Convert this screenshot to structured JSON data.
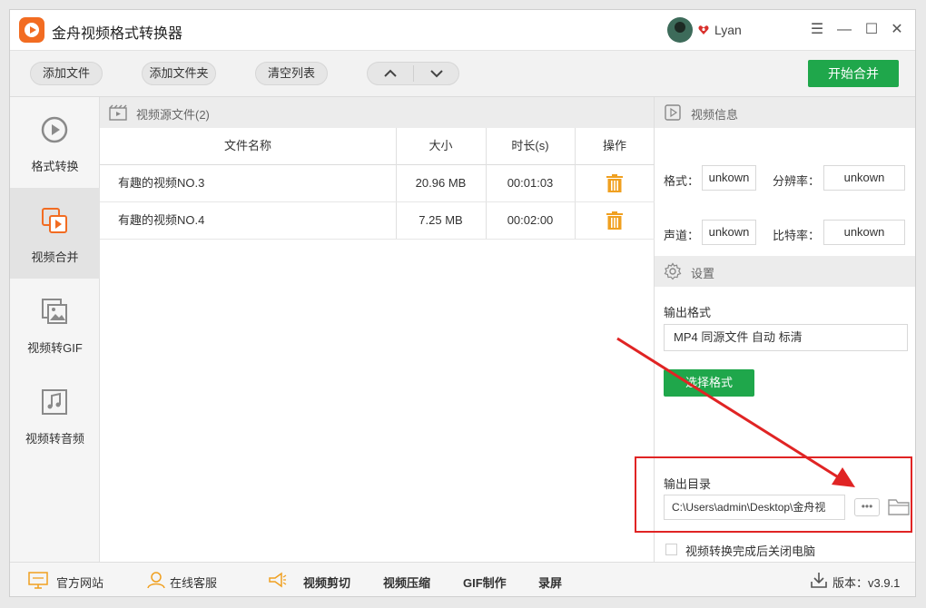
{
  "window": {
    "title": "金舟视频格式转换器",
    "username": "Lyan",
    "controls": [
      "☰",
      "—",
      "☐",
      "✕"
    ]
  },
  "toolbar": {
    "add_file": "添加文件",
    "add_folder": "添加文件夹",
    "clear_list": "清空列表",
    "move_up": "∧",
    "move_down": "∨",
    "start_merge": "开始合并"
  },
  "sidebar": {
    "items": [
      {
        "label": "格式转换",
        "icon": "play-circle-icon"
      },
      {
        "label": "视频合并",
        "icon": "video-merge-icon"
      },
      {
        "label": "视频转GIF",
        "icon": "image-icon"
      },
      {
        "label": "视频转音频",
        "icon": "music-note-icon"
      }
    ]
  },
  "filelist": {
    "title": "视频源文件(2)",
    "headers": {
      "name": "文件名称",
      "size": "大小",
      "duration": "时长(s)",
      "action": "操作"
    },
    "rows": [
      {
        "name": "有趣的视频NO.3",
        "size": "20.96 MB",
        "duration": "00:01:03"
      },
      {
        "name": "有趣的视频NO.4",
        "size": "7.25 MB",
        "duration": "00:02:00"
      }
    ]
  },
  "video_info": {
    "title": "视频信息",
    "format_label": "格式：",
    "format_value": "unkown",
    "resolution_label": "分辨率：",
    "resolution_value": "unkown",
    "audio_label": "声道：",
    "audio_value": "unkown",
    "bitrate_label": "比特率：",
    "bitrate_value": "unkown"
  },
  "settings": {
    "title": "设置",
    "output_format_label": "输出格式",
    "output_format_value": "MP4 同源文件 自动 标清",
    "choose_format": "选择格式",
    "output_dir_label": "输出目录",
    "output_dir_value": "C:\\Users\\admin\\Desktop\\金舟视",
    "more": "•••",
    "shutdown_label": "视频转换完成后关闭电脑"
  },
  "bottom": {
    "website": "官方网站",
    "service": "在线客服",
    "cut": "视频剪切",
    "compress": "视频压缩",
    "gif": "GIF制作",
    "record": "录屏",
    "version": "版本：v3.9.1"
  },
  "colors": {
    "accent_green": "#1fa74b",
    "brand_orange": "#f26c22",
    "trash_orange": "#f0a020",
    "annotation_red": "#e02424"
  }
}
